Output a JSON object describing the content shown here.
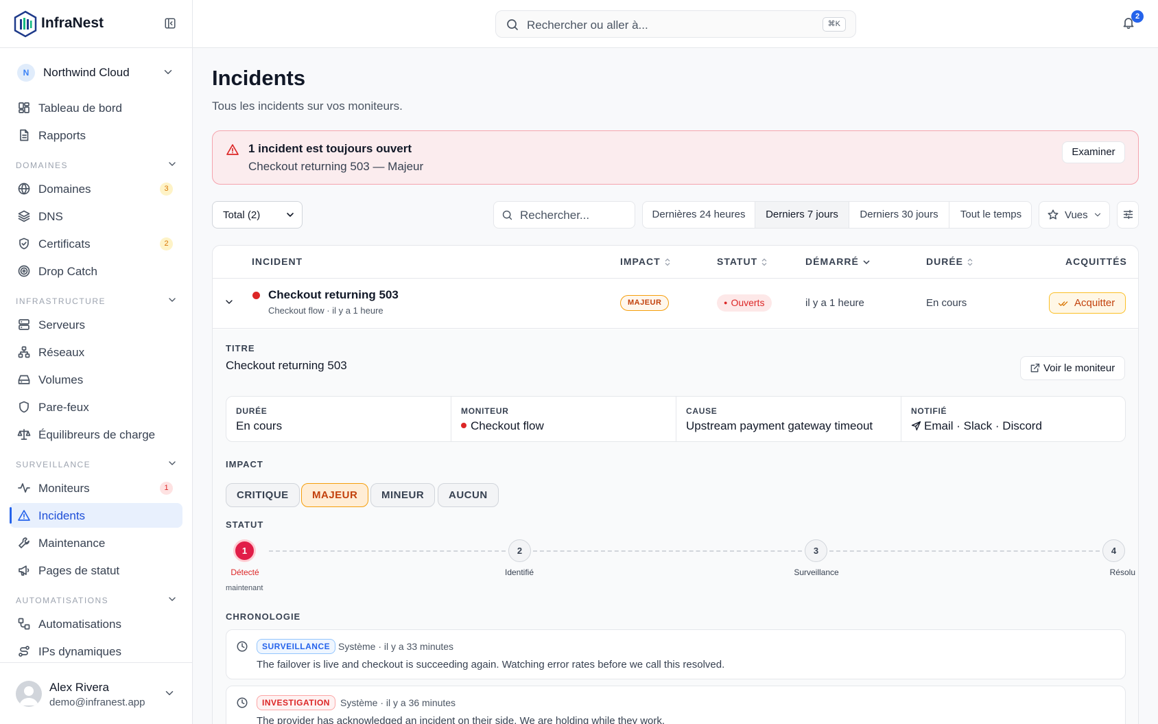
{
  "app": {
    "name": "InfraNest"
  },
  "org": {
    "initial": "N",
    "name": "Northwind Cloud"
  },
  "sidebar": {
    "top_items": [
      {
        "label": "Tableau de bord",
        "icon": "dashboard-icon"
      },
      {
        "label": "Rapports",
        "icon": "report-icon"
      }
    ],
    "sections": [
      {
        "title": "DOMAINES",
        "items": [
          {
            "label": "Domaines",
            "icon": "globe-icon",
            "badge": "3"
          },
          {
            "label": "DNS",
            "icon": "layers-icon"
          },
          {
            "label": "Certificats",
            "icon": "shield-check-icon",
            "badge": "2"
          },
          {
            "label": "Drop Catch",
            "icon": "target-icon"
          }
        ]
      },
      {
        "title": "INFRASTRUCTURE",
        "items": [
          {
            "label": "Serveurs",
            "icon": "server-icon"
          },
          {
            "label": "Réseaux",
            "icon": "network-icon"
          },
          {
            "label": "Volumes",
            "icon": "hard-drive-icon"
          },
          {
            "label": "Pare-feux",
            "icon": "shield-icon"
          },
          {
            "label": "Équilibreurs de charge",
            "icon": "scale-icon"
          }
        ]
      },
      {
        "title": "SURVEILLANCE",
        "items": [
          {
            "label": "Moniteurs",
            "icon": "activity-icon",
            "badge": "1"
          },
          {
            "label": "Incidents",
            "icon": "alert-triangle-icon"
          },
          {
            "label": "Maintenance",
            "icon": "wrench-icon"
          },
          {
            "label": "Pages de statut",
            "icon": "megaphone-icon"
          }
        ]
      },
      {
        "title": "AUTOMATISATIONS",
        "items": [
          {
            "label": "Automatisations",
            "icon": "workflow-icon"
          },
          {
            "label": "IPs dynamiques",
            "icon": "route-icon"
          }
        ]
      }
    ]
  },
  "user": {
    "name": "Alex Rivera",
    "email": "demo@infranest.app"
  },
  "topbar": {
    "search_placeholder": "Rechercher ou aller à...",
    "shortcut": "⌘K",
    "notif_count": "2"
  },
  "page": {
    "title": "Incidents",
    "subtitle": "Tous les incidents sur vos moniteurs."
  },
  "alert": {
    "title": "1 incident est toujours ouvert",
    "detail": "Checkout returning 503 — Majeur",
    "button": "Examiner"
  },
  "filters": {
    "total": "Total (2)",
    "search_placeholder": "Rechercher...",
    "ranges": [
      "Dernières 24 heures",
      "Derniers 7 jours",
      "Derniers 30 jours",
      "Tout le temps"
    ],
    "active_range": "Derniers 7 jours",
    "views": "Vues"
  },
  "table": {
    "headers": {
      "incident": "INCIDENT",
      "impact": "IMPACT",
      "status": "STATUT",
      "started": "DÉMARRÉ",
      "duration": "DURÉE",
      "ack": "ACQUITTÉS"
    },
    "row": {
      "title": "Checkout returning 503",
      "sub": "Checkout flow · il y a 1 heure",
      "impact": "MAJEUR",
      "status": "Ouverts",
      "started": "il y a 1 heure",
      "duration": "En cours",
      "ack_button": "Acquitter"
    }
  },
  "detail": {
    "title_label": "TITRE",
    "title": "Checkout returning 503",
    "monitor_button": "Voir le moniteur",
    "cards": [
      {
        "key": "DURÉE",
        "value": "En cours"
      },
      {
        "key": "MONITEUR",
        "value": "Checkout flow"
      },
      {
        "key": "CAUSE",
        "value": "Upstream payment gateway timeout"
      },
      {
        "key": "NOTIFIÉ",
        "value": "Email · Slack · Discord"
      }
    ],
    "impact_label": "IMPACT",
    "impacts": [
      "CRITIQUE",
      "MAJEUR",
      "MINEUR",
      "AUCUN"
    ],
    "impact_selected": "MAJEUR",
    "status_label": "STATUT",
    "steps": [
      {
        "n": "1",
        "label": "Détecté"
      },
      {
        "n": "2",
        "label": "Identifié"
      },
      {
        "n": "3",
        "label": "Surveillance"
      },
      {
        "n": "4",
        "label": "Résolu"
      }
    ],
    "step_when": "maintenant",
    "timeline_label": "CHRONOLOGIE",
    "timeline": [
      {
        "tag": "SURVEILLANCE",
        "meta": "Système · il y a 33 minutes",
        "text": "The failover is live and checkout is succeeding again. Watching error rates before we call this resolved."
      },
      {
        "tag": "INVESTIGATION",
        "meta": "Système · il y a 36 minutes",
        "text": "The provider has acknowledged an incident on their side. We are holding while they work."
      }
    ]
  },
  "colors": {
    "accent": "#2563eb",
    "danger": "#dc2626",
    "warning": "#d97706"
  }
}
